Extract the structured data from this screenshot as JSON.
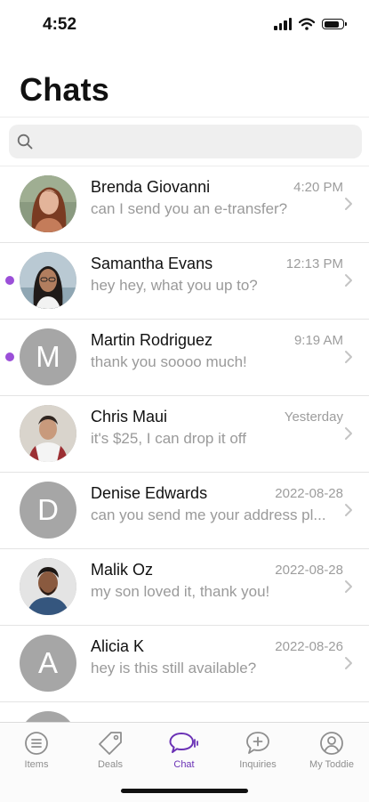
{
  "status_bar": {
    "time": "4:52"
  },
  "header": {
    "title": "Chats"
  },
  "search": {
    "placeholder": ""
  },
  "chats": [
    {
      "name": "Brenda Giovanni",
      "time": "4:20 PM",
      "preview": "can I send you an e-transfer?",
      "unread": false,
      "avatar": "photo"
    },
    {
      "name": "Samantha Evans",
      "time": "12:13 PM",
      "preview": "hey hey, what you up to?",
      "unread": true,
      "avatar": "photo"
    },
    {
      "name": "Martin Rodriguez",
      "time": "9:19 AM",
      "preview": "thank you soooo much!",
      "unread": true,
      "avatar": "letter",
      "initial": "M"
    },
    {
      "name": "Chris Maui",
      "time": "Yesterday",
      "preview": "it's $25, I can drop it off",
      "unread": false,
      "avatar": "photo"
    },
    {
      "name": "Denise Edwards",
      "time": "2022-08-28",
      "preview": "can you send me your address pl...",
      "unread": false,
      "avatar": "letter",
      "initial": "D"
    },
    {
      "name": "Malik Oz",
      "time": "2022-08-28",
      "preview": "my son loved it, thank you!",
      "unread": false,
      "avatar": "photo"
    },
    {
      "name": "Alicia K",
      "time": "2022-08-26",
      "preview": "hey is this still available?",
      "unread": false,
      "avatar": "letter",
      "initial": "A"
    }
  ],
  "tabs": [
    {
      "label": "Items",
      "icon": "items-icon",
      "active": false
    },
    {
      "label": "Deals",
      "icon": "tag-icon",
      "active": false
    },
    {
      "label": "Chat",
      "icon": "chat-icon",
      "active": true
    },
    {
      "label": "Inquiries",
      "icon": "inquiry-icon",
      "active": false
    },
    {
      "label": "My Toddie",
      "icon": "profile-icon",
      "active": false
    }
  ],
  "colors": {
    "accent": "#6a31b5",
    "unread_dot": "#9b4fd8",
    "avatar_placeholder": "#a6a6a6"
  }
}
